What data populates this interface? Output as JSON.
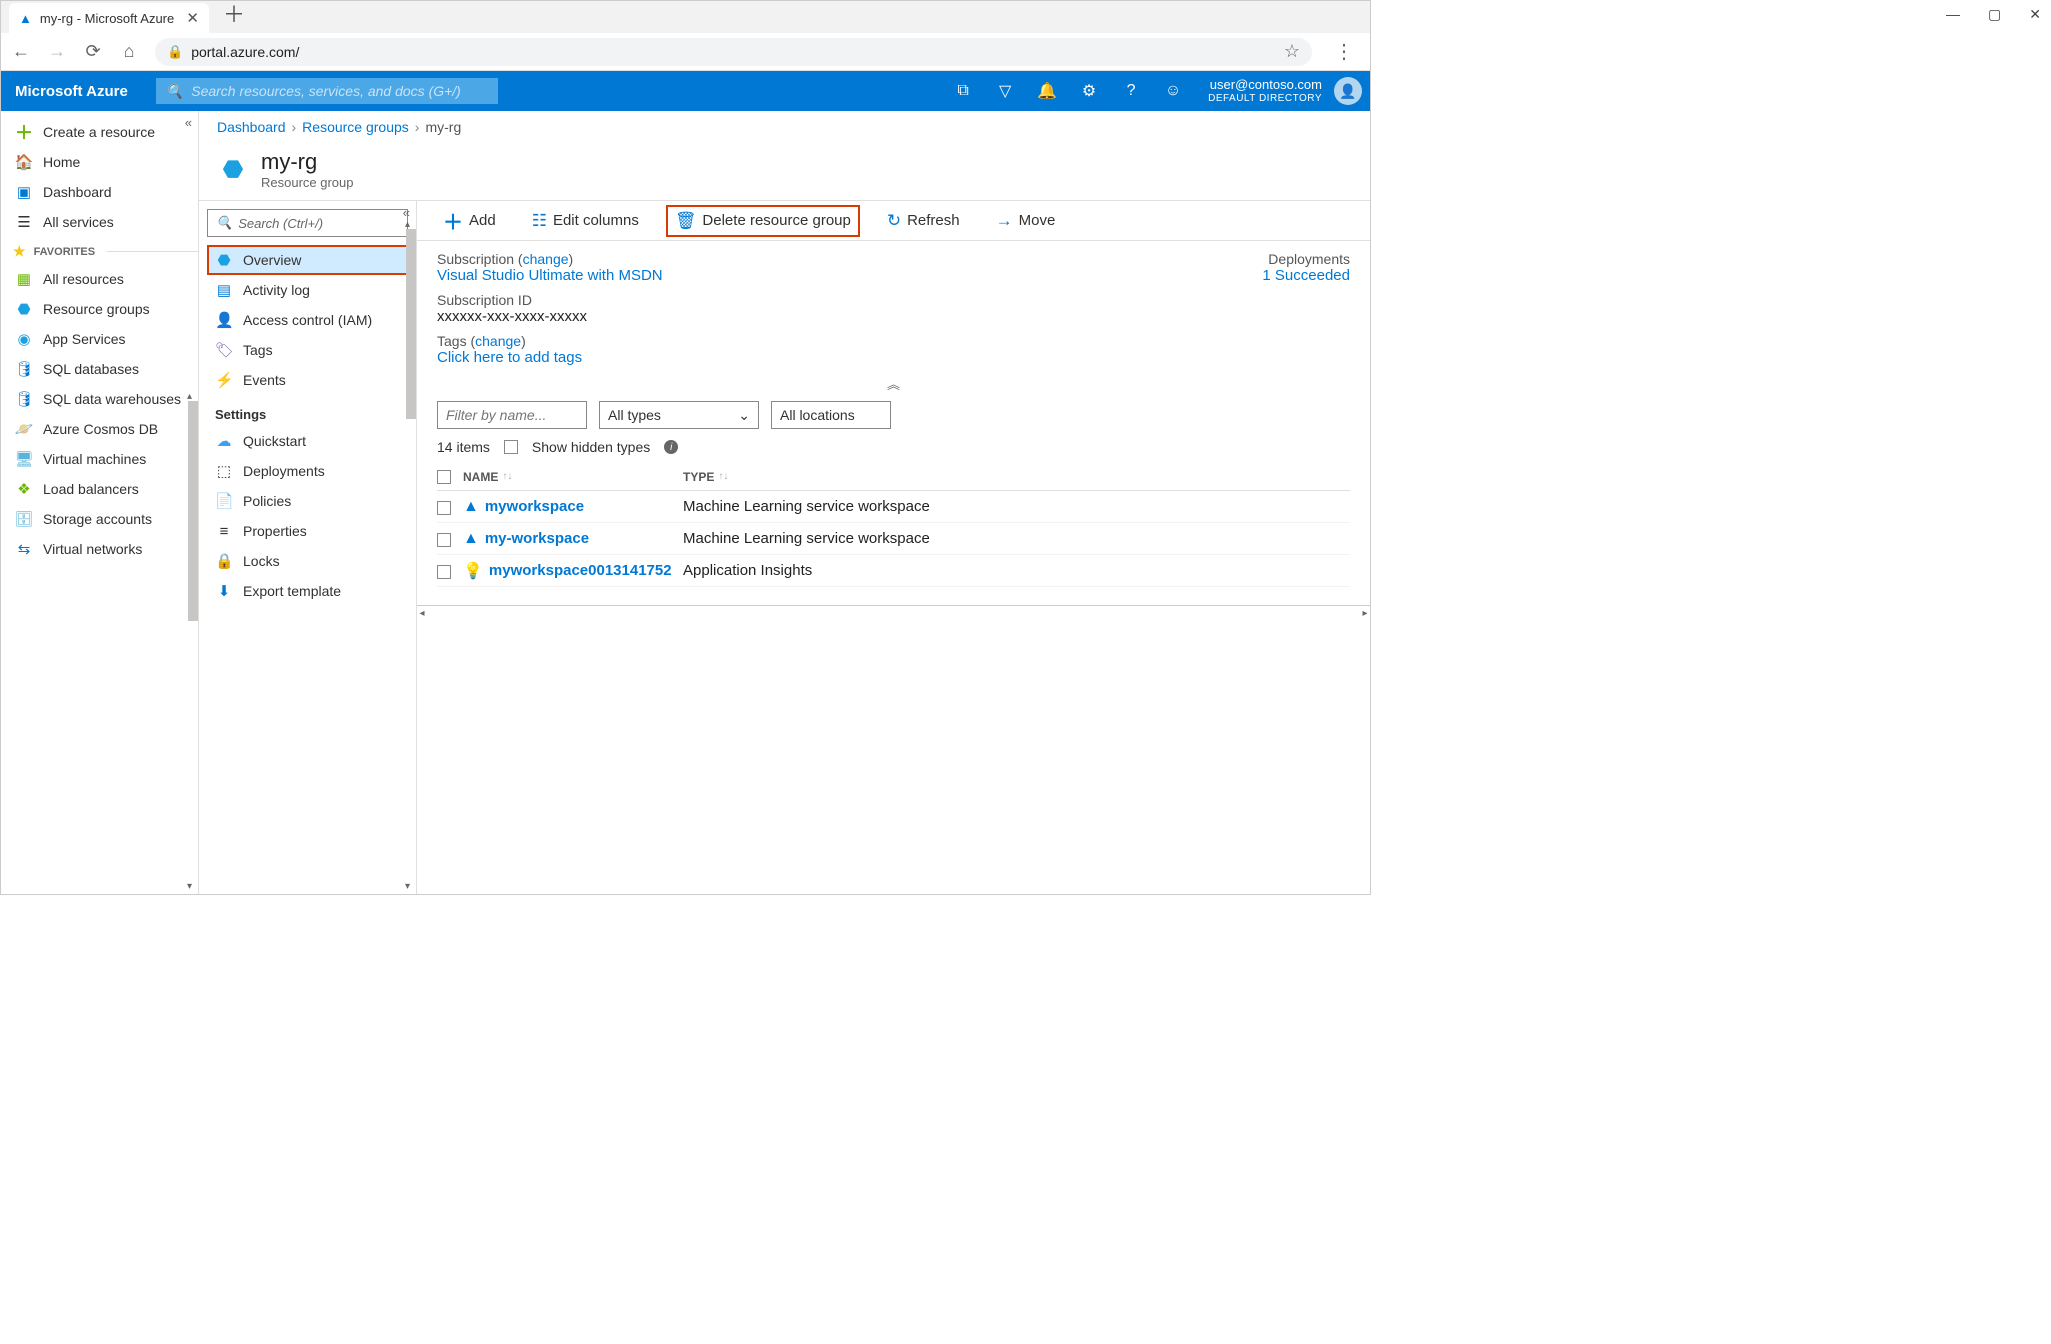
{
  "browser": {
    "tab_title": "my-rg - Microsoft Azure",
    "url": "portal.azure.com/"
  },
  "window_controls": {
    "min": "—",
    "max": "▢",
    "close": "✕"
  },
  "azure": {
    "brand": "Microsoft Azure",
    "search_placeholder": "Search resources, services, and docs (G+/)",
    "user_email": "user@contoso.com",
    "user_dir": "DEFAULT DIRECTORY"
  },
  "leftnav": {
    "create": "Create a resource",
    "home": "Home",
    "dashboard": "Dashboard",
    "all_services": "All services",
    "favorites_label": "FAVORITES",
    "items": [
      {
        "label": "All resources",
        "icon": "▦",
        "color": "#6bb700"
      },
      {
        "label": "Resource groups",
        "icon": "⬣",
        "color": "#1ba1e2"
      },
      {
        "label": "App Services",
        "icon": "◉",
        "color": "#1ba1e2"
      },
      {
        "label": "SQL databases",
        "icon": "🛢",
        "color": "#0078d4"
      },
      {
        "label": "SQL data warehouses",
        "icon": "🛢",
        "color": "#0078d4"
      },
      {
        "label": "Azure Cosmos DB",
        "icon": "🪐",
        "color": "#333"
      },
      {
        "label": "Virtual machines",
        "icon": "🖥",
        "color": "#59b4d9"
      },
      {
        "label": "Load balancers",
        "icon": "❖",
        "color": "#6bb700"
      },
      {
        "label": "Storage accounts",
        "icon": "🗄",
        "color": "#59b4d9"
      },
      {
        "label": "Virtual networks",
        "icon": "⇆",
        "color": "#0078d4"
      }
    ]
  },
  "breadcrumb": {
    "dashboard": "Dashboard",
    "rg": "Resource groups",
    "current": "my-rg"
  },
  "rg_header": {
    "title": "my-rg",
    "subtitle": "Resource group"
  },
  "blade_menu": {
    "search_placeholder": "Search (Ctrl+/)",
    "items": [
      {
        "label": "Overview",
        "icon": "⬣",
        "color": "#1ba1e2",
        "active": true
      },
      {
        "label": "Activity log",
        "icon": "▤",
        "color": "#0078d4"
      },
      {
        "label": "Access control (IAM)",
        "icon": "👤",
        "color": "#0078d4"
      },
      {
        "label": "Tags",
        "icon": "🏷",
        "color": "#8764b8"
      },
      {
        "label": "Events",
        "icon": "⚡",
        "color": "#ffb900"
      }
    ],
    "settings_label": "Settings",
    "settings": [
      {
        "label": "Quickstart",
        "icon": "☁",
        "color": "#3aa0f3"
      },
      {
        "label": "Deployments",
        "icon": "⬚",
        "color": "#323130"
      },
      {
        "label": "Policies",
        "icon": "📄",
        "color": "#59b4d9"
      },
      {
        "label": "Properties",
        "icon": "≡",
        "color": "#323130"
      },
      {
        "label": "Locks",
        "icon": "🔒",
        "color": "#323130"
      },
      {
        "label": "Export template",
        "icon": "⬇",
        "color": "#0078d4"
      }
    ]
  },
  "toolbar": {
    "add": "Add",
    "edit": "Edit columns",
    "delete": "Delete resource group",
    "refresh": "Refresh",
    "move": "Move"
  },
  "props": {
    "sub_label": "Subscription (",
    "change": "change",
    "close_paren": ")",
    "sub_value": "Visual Studio Ultimate with MSDN",
    "subid_label": "Subscription ID",
    "subid_value": "xxxxxx-xxx-xxxx-xxxxx",
    "tags_label": "Tags (",
    "tags_value": "Click here to add tags",
    "dep_label": "Deployments",
    "dep_value": "1 Succeeded"
  },
  "filters": {
    "name_placeholder": "Filter by name...",
    "types": "All types",
    "locations": "All locations"
  },
  "summary": {
    "count": "14 items",
    "hidden": "Show hidden types"
  },
  "grid": {
    "col_name": "NAME",
    "col_type": "TYPE",
    "rows": [
      {
        "name": "myworkspace",
        "type": "Machine Learning service workspace",
        "icon": "▲",
        "color": "#0078d4"
      },
      {
        "name": "my-workspace",
        "type": "Machine Learning service workspace",
        "icon": "▲",
        "color": "#0078d4"
      },
      {
        "name": "myworkspace0013141752",
        "type": "Application Insights",
        "icon": "💡",
        "color": "#8764b8"
      }
    ]
  }
}
